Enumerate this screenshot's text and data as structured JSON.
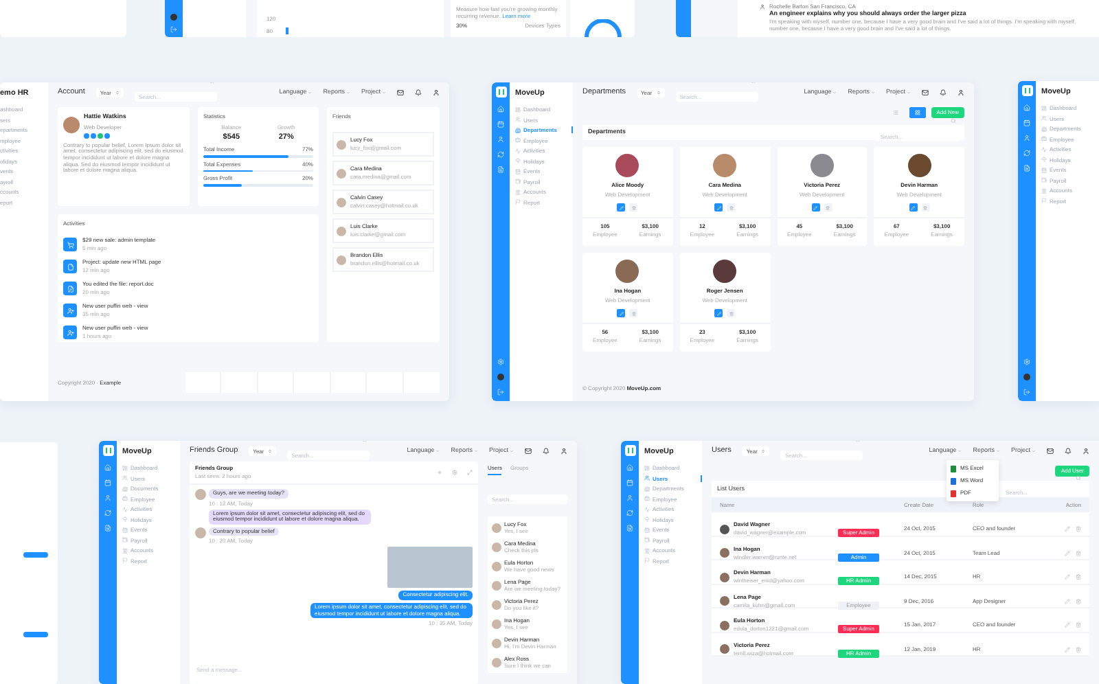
{
  "top_strip": {
    "axis_labels": [
      "120",
      "80"
    ],
    "revenue_note": "Measure how fast you're growing monthly recurring revenue.",
    "revenue_link": "Learn more",
    "device_share": "30%",
    "device_label": "Devices Types",
    "post_author": "Rochelle Barton San Francisco, CA",
    "post_title": "An engineer explains why you should always order the larger pizza",
    "post_body": "I'm speaking with myself, number one, because I have a very good brain and I've said a lot of things. I'm speaking with myself, number one, because I have a very good brain and I've said a lot of things."
  },
  "account_screen": {
    "brand": "emo HR",
    "nav": [
      {
        "label": "ashboard",
        "selected": false
      },
      {
        "label": "sers",
        "selected": false
      },
      {
        "label": "epartments",
        "selected": false
      },
      {
        "label": "mployee",
        "selected": false
      },
      {
        "label": "ctivities",
        "selected": false
      },
      {
        "label": "olidays",
        "selected": false
      },
      {
        "label": "vents",
        "selected": false
      },
      {
        "label": "ayroll",
        "selected": false
      },
      {
        "label": "ccounts",
        "selected": false
      },
      {
        "label": "eport",
        "selected": false
      }
    ],
    "header": {
      "title": "Account",
      "year": "Year",
      "search_placeholder": "Search...",
      "menus": [
        "Language",
        "Reports",
        "Project"
      ]
    },
    "profile": {
      "name": "Hattie Watkins",
      "role": "Web Developer",
      "bio": "Contrary to popular belief, Lorem Ipsum dolor sit amet, consectetur adipiscing elit, sed do eiusmod tempor incididunt ut labore et dolore magna aliqua. Sed do eiusmod tempor incididunt ut labore et dolore magna aliqua."
    },
    "statistics": {
      "title": "Statistics",
      "figures": [
        {
          "label": "Balance",
          "value": "$545"
        },
        {
          "label": "Growth",
          "value": "27%"
        }
      ],
      "bars": [
        {
          "label": "Total Income",
          "reading": "77%",
          "level": 0.77
        },
        {
          "label": "Total Expenses",
          "reading": "40%",
          "level": 0.45
        },
        {
          "label": "Gross Profit",
          "reading": "20%",
          "level": 0.35
        }
      ]
    },
    "friends": {
      "title": "Friends",
      "items": [
        {
          "name": "Lucy Fox",
          "email": "lucy_fox@gmail.com"
        },
        {
          "name": "Cara Medina",
          "email": "cara.medina@gmail.com"
        },
        {
          "name": "Calvin Casey",
          "email": "calvin.casey@hotmail.co.uk"
        },
        {
          "name": "Luis Clarke",
          "email": "luis.clarke@gmail.com"
        },
        {
          "name": "Brandon Ellis",
          "email": "brandon.ellis@hotmail.co.uk"
        }
      ]
    },
    "activities": {
      "title": "Activities",
      "items": [
        {
          "text": "$29 new sale: admin template",
          "time": "5 min ago"
        },
        {
          "text": "Project: update new HTML page",
          "time": "12 min ago"
        },
        {
          "text": "You edited the file: report.doc",
          "time": "20 min ago"
        },
        {
          "text": "New user puffin web - view",
          "time": "35 min ago"
        },
        {
          "text": "New user puffin web - view",
          "time": "1 hours ago"
        }
      ]
    },
    "footer_prefix": "Copyright 2020 ·",
    "footer_link": "Example"
  },
  "departments_screen": {
    "brand": "MoveUp",
    "nav": [
      {
        "label": "Dashboard",
        "selected": false
      },
      {
        "label": "Users",
        "selected": false
      },
      {
        "label": "Departments",
        "selected": true
      },
      {
        "label": "Employee",
        "selected": false
      },
      {
        "label": "Activities",
        "selected": false
      },
      {
        "label": "Holidays",
        "selected": false
      },
      {
        "label": "Events",
        "selected": false
      },
      {
        "label": "Payroll",
        "selected": false
      },
      {
        "label": "Accounts",
        "selected": false
      },
      {
        "label": "Report",
        "selected": false
      }
    ],
    "header": {
      "title": "Departments",
      "year": "Year",
      "search_placeholder": "Search...",
      "menus": [
        "Language",
        "Reports",
        "Project"
      ]
    },
    "view_modes": [
      {
        "kind": "list",
        "selected": false
      },
      {
        "kind": "grid",
        "selected": true
      }
    ],
    "add_button": "Add New",
    "panel_title": "Departments",
    "search_placeholder": "Search...",
    "cards": [
      {
        "name": "Alice Moody",
        "department": "Web Development",
        "employees": "105",
        "employees_label": "Employee",
        "earnings": "$3,100",
        "earnings_label": "Earnings"
      },
      {
        "name": "Cara Medina",
        "department": "Web Development",
        "employees": "12",
        "employees_label": "Employee",
        "earnings": "$3,100",
        "earnings_label": "Earnings"
      },
      {
        "name": "Victoria Perez",
        "department": "Web Development",
        "employees": "45",
        "employees_label": "Employee",
        "earnings": "$3,100",
        "earnings_label": "Earnings"
      },
      {
        "name": "Devin Harman",
        "department": "Web Development",
        "employees": "67",
        "employees_label": "Employee",
        "earnings": "$3,100",
        "earnings_label": "Earnings"
      },
      {
        "name": "Ina Hogan",
        "department": "Web Development",
        "employees": "56",
        "employees_label": "Employee",
        "earnings": "$3,100",
        "earnings_label": "Earnings"
      },
      {
        "name": "Roger Jensen",
        "department": "Web Development",
        "employees": "23",
        "employees_label": "Employee",
        "earnings": "$3,100",
        "earnings_label": "Earnings"
      }
    ],
    "footer_prefix": "© Copyright 2020",
    "footer_link": "MoveUp.com"
  },
  "right_screen": {
    "brand": "MoveUp",
    "nav": [
      {
        "label": "Dashboard",
        "selected": false
      },
      {
        "label": "Users",
        "selected": false
      },
      {
        "label": "Departments",
        "selected": false
      },
      {
        "label": "Employee",
        "selected": false
      },
      {
        "label": "Activities",
        "selected": false
      },
      {
        "label": "Holidays",
        "selected": false
      },
      {
        "label": "Events",
        "selected": false
      },
      {
        "label": "Payroll",
        "selected": false
      },
      {
        "label": "Accounts",
        "selected": false
      },
      {
        "label": "Report",
        "selected": false
      }
    ]
  },
  "friends_screen": {
    "brand": "MoveUp",
    "nav": [
      {
        "label": "Dashboard",
        "selected": false
      },
      {
        "label": "Users",
        "selected": false
      },
      {
        "label": "Documents",
        "selected": false
      },
      {
        "label": "Employee",
        "selected": false
      },
      {
        "label": "Activities",
        "selected": false
      },
      {
        "label": "Holidays",
        "selected": false
      },
      {
        "label": "Events",
        "selected": false
      },
      {
        "label": "Payroll",
        "selected": false
      },
      {
        "label": "Accounts",
        "selected": false
      },
      {
        "label": "Report",
        "selected": false
      }
    ],
    "header": {
      "title": "Friends Group",
      "year": "Year",
      "search_placeholder": "Search...",
      "menus": [
        "Language",
        "Reports",
        "Project"
      ]
    },
    "chat": {
      "title": "Friends Group",
      "last_seen": "Last seen: 2 hours ago",
      "messages": [
        {
          "kind": "incoming",
          "avatar": true,
          "text": "Guys, are we meeting today?",
          "time": "10 : 12 AM, Today"
        },
        {
          "kind": "incoming",
          "avatar": false,
          "text": "Lorem ipsum dolor sit amet, consectetur adipiscing elit, sed do eiusmod tempor incididunt ut labore et dolore magna aliqua."
        },
        {
          "kind": "incoming",
          "avatar": true,
          "text": "Contrary to popular belief",
          "time": "10 : 20 AM, Today"
        },
        {
          "kind": "photo"
        },
        {
          "kind": "outgoing",
          "text": "Consectetur adipiscing elit."
        },
        {
          "kind": "outgoing",
          "text": "Lorem ipsum dolor sit amet, consectetur adipiscing elit, sed do eiusmod tempor incididunt ut labore et dolore magna aliqua.",
          "time": "10 : 35 AM, Today"
        }
      ],
      "input_placeholder": "Send a message..."
    },
    "tabs": [
      {
        "label": "Users",
        "selected": true
      },
      {
        "label": "Groups",
        "selected": false
      }
    ],
    "contacts_search_placeholder": "Search...",
    "contacts": [
      {
        "name": "Lucy Fox",
        "preview": "Yes, I see"
      },
      {
        "name": "Cara Medina",
        "preview": "Check this pls"
      },
      {
        "name": "Eula Horton",
        "preview": "We have good news"
      },
      {
        "name": "Lena Page",
        "preview": "Are we meeting today?"
      },
      {
        "name": "Victoria Perez",
        "preview": "Do you like it?"
      },
      {
        "name": "Ina Hogan",
        "preview": "Yes, I see"
      },
      {
        "name": "Devin Harman",
        "preview": "Hi, I'm Devin Harman"
      },
      {
        "name": "Alex Ross",
        "preview": "Sure I think we can"
      }
    ]
  },
  "users_screen": {
    "brand": "MoveUp",
    "nav": [
      {
        "label": "Dashboard",
        "selected": false
      },
      {
        "label": "Users",
        "selected": true
      },
      {
        "label": "Departments",
        "selected": false
      },
      {
        "label": "Employee",
        "selected": false
      },
      {
        "label": "Activities",
        "selected": false
      },
      {
        "label": "Holidays",
        "selected": false
      },
      {
        "label": "Events",
        "selected": false
      },
      {
        "label": "Payroll",
        "selected": false
      },
      {
        "label": "Accounts",
        "selected": false
      },
      {
        "label": "Report",
        "selected": false
      }
    ],
    "header": {
      "title": "Users",
      "year": "Year",
      "search_placeholder": "Search...",
      "menus": [
        "Language",
        "Reports",
        "Project"
      ]
    },
    "reports_menu": [
      {
        "kind": "excel",
        "label": "MS Excel"
      },
      {
        "kind": "word",
        "label": "MS Word"
      },
      {
        "kind": "pdf",
        "label": "PDF"
      }
    ],
    "add_button": "Add User",
    "panel_title": "List Users",
    "search_placeholder": "Search...",
    "columns": [
      "Name",
      "Create Date",
      "Role",
      "Action"
    ],
    "rows": [
      {
        "kind": "super",
        "name": "David Wagner",
        "email": "david_wagner@example.com",
        "badge": "Super Admin",
        "date": "24 Oct, 2015",
        "role": "CEO and founder"
      },
      {
        "kind": "admin",
        "name": "Ina Hogan",
        "email": "windler.warren@runte.net",
        "badge": "Admin",
        "date": "24 Oct, 2015",
        "role": "Team Lead"
      },
      {
        "kind": "hr",
        "name": "Devin Harman",
        "email": "wintheiser_enid@yahoo.com",
        "badge": "HR Admin",
        "date": "14 Dec, 2015",
        "role": "HR"
      },
      {
        "kind": "employee",
        "name": "Lena Page",
        "email": "camila_kuhn@gmail.com",
        "badge": "Employee",
        "date": "9 Dec, 2016",
        "role": "App Designer"
      },
      {
        "kind": "super",
        "name": "Eula Horton",
        "email": "edula_dorton1221@gmail.com",
        "badge": "Super Admin",
        "date": "15 Jan, 2017",
        "role": "CEO and founder"
      },
      {
        "kind": "hr",
        "name": "Victoria Perez",
        "email": "terrill.wiza@hotmail.com",
        "badge": "HR Admin",
        "date": "12 Jan, 2019",
        "role": "HR"
      }
    ]
  }
}
